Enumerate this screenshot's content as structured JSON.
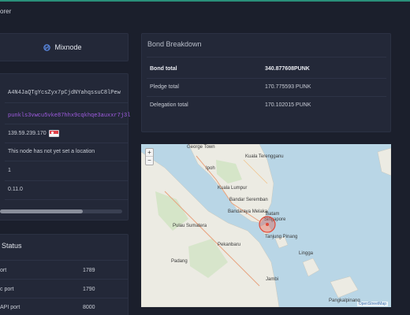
{
  "header": {
    "app_title": "orer"
  },
  "mixnode": {
    "label": "Mixnode",
    "icon": "nym-logo-icon"
  },
  "info": {
    "identity_key": "A4N4JaQTgYcsZyx7pCjdNYahqssuC8lPew",
    "owner_address": "punkls3vwcu5vke87hhx9cqkhqe3auxxr7j3l",
    "host": "139.59.239.170",
    "country_flag": "singapore-flag-icon",
    "location": "This node has not yet set a location",
    "layer": "1",
    "version": "0.11.0",
    "scroll_fraction": 0.68
  },
  "status": {
    "title": "Status",
    "ports": [
      {
        "label": "ort",
        "value": "1789"
      },
      {
        "label": "c port",
        "value": "1790"
      },
      {
        "label": "API port",
        "value": "8000"
      }
    ]
  },
  "bond": {
    "title": "Bond Breakdown",
    "rows": [
      {
        "label": "Bond total",
        "value": "340.877608PUNK"
      },
      {
        "label": "Pledge total",
        "value": "170.775593 PUNK"
      },
      {
        "label": "Delegation total",
        "value": "170.102015 PUNK"
      }
    ]
  },
  "map": {
    "zoom_in": "+",
    "zoom_out": "−",
    "attribution": "OpenStreetMap",
    "labels": [
      "George Town",
      "Kuala Terengganu",
      "Ipoh",
      "Kuala Lumpur",
      "Bandar Seremban",
      "Bandaraya Melaka",
      "Pekanbaru",
      "Batam",
      "Tanjung Pinang",
      "Jambi",
      "Pangkalpinang",
      "Singapore",
      "Padang",
      "Lingga",
      "Pulau Sumatera"
    ],
    "colors": {
      "sea": "#b9d6e6",
      "land": "#ecebe3",
      "marker": "#e04a3a"
    }
  }
}
